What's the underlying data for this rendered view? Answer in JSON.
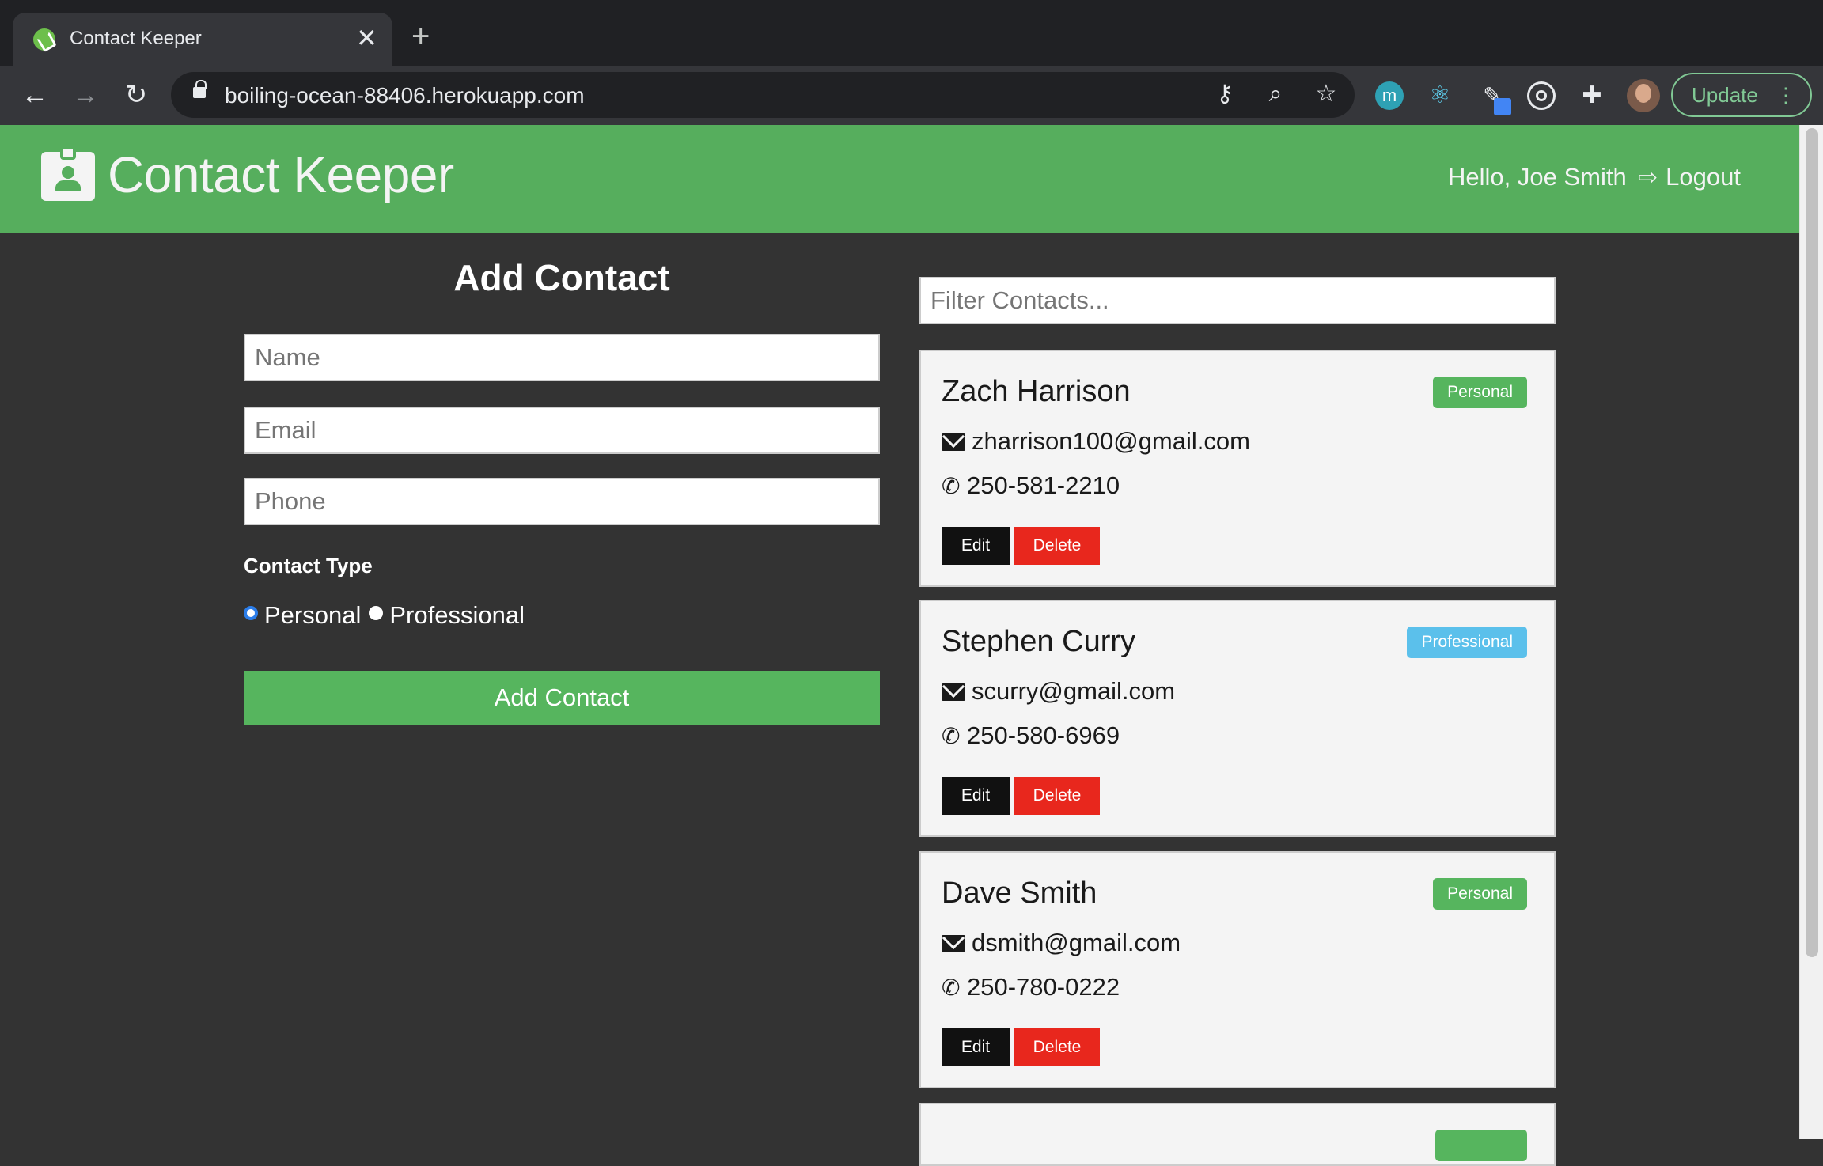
{
  "browser": {
    "tab_title": "Contact Keeper",
    "url": "boiling-ocean-88406.herokuapp.com",
    "update_label": "Update",
    "extension_m_label": "m"
  },
  "navbar": {
    "brand": "Contact Keeper",
    "greeting": "Hello, Joe Smith",
    "logout_label": "Logout"
  },
  "form": {
    "title": "Add Contact",
    "name_placeholder": "Name",
    "email_placeholder": "Email",
    "phone_placeholder": "Phone",
    "contact_type_label": "Contact Type",
    "type_options": [
      "Personal",
      "Professional"
    ],
    "selected_type": "Personal",
    "submit_label": "Add Contact"
  },
  "filter": {
    "placeholder": "Filter Contacts..."
  },
  "contacts": [
    {
      "name": "Zach Harrison",
      "type": "Personal",
      "email": "zharrison100@gmail.com",
      "phone": "250-581-2210",
      "edit_label": "Edit",
      "delete_label": "Delete"
    },
    {
      "name": "Stephen Curry",
      "type": "Professional",
      "email": "scurry@gmail.com",
      "phone": "250-580-6969",
      "edit_label": "Edit",
      "delete_label": "Delete"
    },
    {
      "name": "Dave Smith",
      "type": "Personal",
      "email": "dsmith@gmail.com",
      "phone": "250-780-0222",
      "edit_label": "Edit",
      "delete_label": "Delete"
    }
  ],
  "colors": {
    "primary": "#56ae5d",
    "dark_bg": "#333333",
    "personal_badge": "#56b55e",
    "professional_badge": "#5bc0eb",
    "danger": "#e8271d",
    "edit_button": "#111111"
  }
}
